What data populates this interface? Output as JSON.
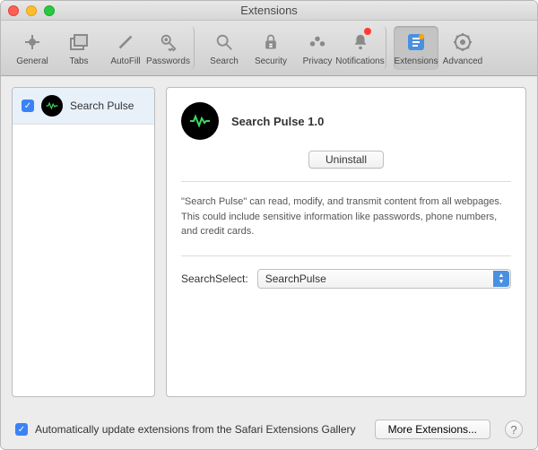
{
  "window": {
    "title": "Extensions"
  },
  "toolbar": {
    "items": [
      {
        "label": "General"
      },
      {
        "label": "Tabs"
      },
      {
        "label": "AutoFill"
      },
      {
        "label": "Passwords"
      },
      {
        "label": "Search"
      },
      {
        "label": "Security"
      },
      {
        "label": "Privacy"
      },
      {
        "label": "Notifications"
      },
      {
        "label": "Extensions"
      },
      {
        "label": "Advanced"
      }
    ]
  },
  "sidebar": {
    "items": [
      {
        "name": "Search Pulse",
        "checked": true
      }
    ]
  },
  "detail": {
    "title": "Search Pulse 1.0",
    "uninstall": "Uninstall",
    "description": "\"Search Pulse\" can read, modify, and transmit content from all webpages. This could include sensitive information like passwords, phone numbers, and credit cards.",
    "selectLabel": "SearchSelect:",
    "selectValue": "SearchPulse"
  },
  "bottom": {
    "autoUpdate": "Automatically update extensions from the Safari Extensions Gallery",
    "more": "More Extensions..."
  }
}
